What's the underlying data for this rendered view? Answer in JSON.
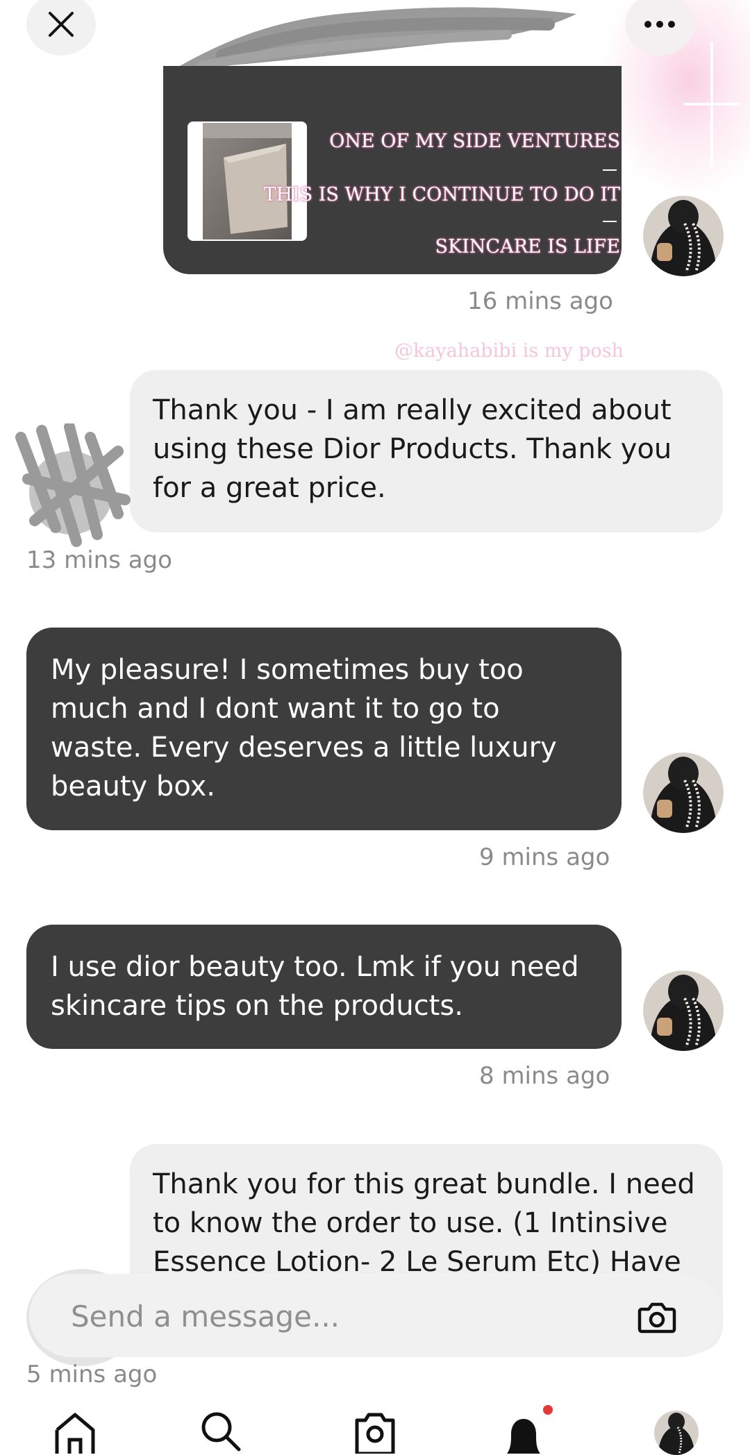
{
  "header": {
    "close_icon": "close-icon",
    "more_icon": "more-horizontal-icon"
  },
  "post": {
    "caption": [
      "ONE OF MY SIDE VENTURES",
      "THIS IS WHY I CONTINUE TO DO IT",
      "SKINCARE IS LIFE"
    ],
    "timestamp": "16 mins ago",
    "watermark": "@kayahabibi is my posh"
  },
  "messages": [
    {
      "sender": "other",
      "text": "Thank you - I am really excited about using these Dior Products. Thank you for a great price.",
      "timestamp": "13 mins ago"
    },
    {
      "sender": "me",
      "text": "My pleasure! I sometimes buy too much and I dont want it to go to waste. Every deserves a little luxury beauty box.",
      "timestamp": "9 mins ago"
    },
    {
      "sender": "me",
      "text": "I use dior beauty too. Lmk if you need skincare tips on the products.",
      "timestamp": "8 mins ago"
    },
    {
      "sender": "other",
      "text": "Thank you for this great bundle. I need to know the order to use. (1 Intinsive Essence Lotion- 2 Le Serum Etc) Have",
      "timestamp": "5 mins ago"
    }
  ],
  "composer": {
    "placeholder": "Send a message...",
    "camera_icon": "camera-icon"
  },
  "nav": {
    "items": [
      "home-icon",
      "search-icon",
      "camera-icon",
      "bell-icon",
      "profile-avatar"
    ],
    "notification_dot_color": "#e53935"
  },
  "colors": {
    "dark_bubble": "#3d3d3d",
    "light_bubble": "#efefef",
    "timestamp": "#8a8a8a"
  }
}
